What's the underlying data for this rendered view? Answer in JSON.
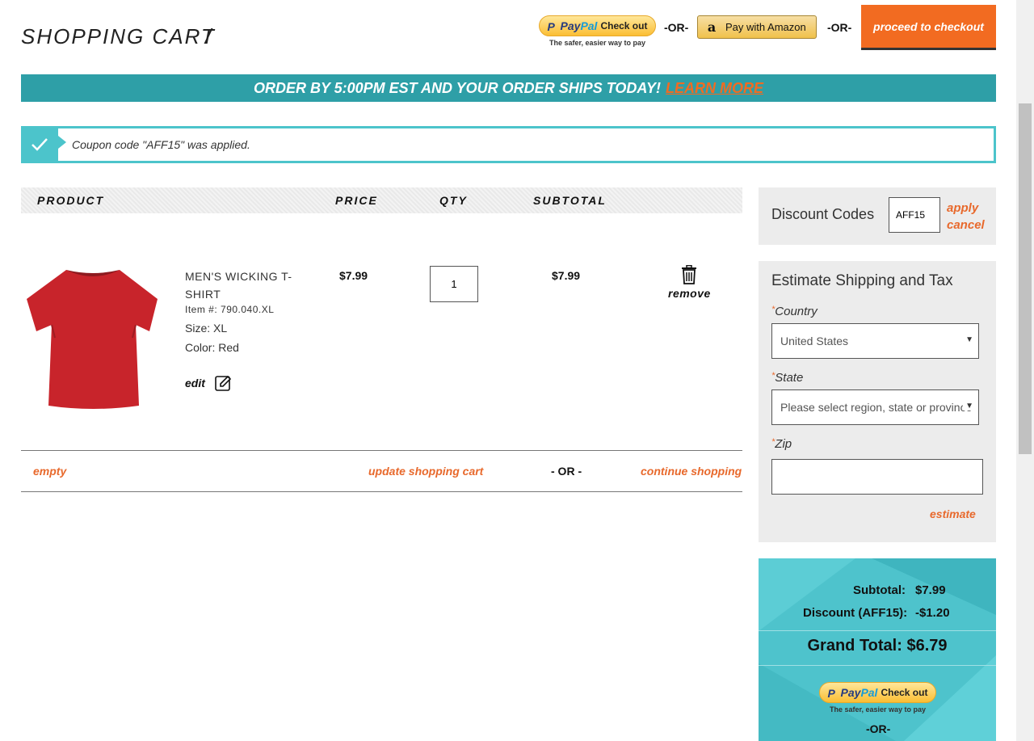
{
  "header": {
    "title": "SHOPPING CART",
    "slash": "/",
    "paypal": {
      "paypal_part1": "Pay",
      "paypal_part2": "Pal",
      "checkout": "Check out",
      "tagline": "The safer, easier way to pay"
    },
    "or1": "-OR-",
    "amazon_label": "Pay with Amazon",
    "or2": "-OR-",
    "checkout_label": "proceed to checkout"
  },
  "banner": {
    "text": "ORDER BY 5:00PM EST AND YOUR ORDER SHIPS TODAY!",
    "link": "LEARN MORE"
  },
  "coupon_message": "Coupon code \"AFF15\" was applied.",
  "table": {
    "headers": {
      "product": "PRODUCT",
      "price": "PRICE",
      "qty": "QTY",
      "subtotal": "SUBTOTAL"
    }
  },
  "item": {
    "name": "MEN'S WICKING T-SHIRT",
    "item_no": "Item #: 790.040.XL",
    "size": "Size: XL",
    "color": "Color: Red",
    "edit": "edit",
    "price": "$7.99",
    "qty": "1",
    "subtotal": "$7.99",
    "remove": "remove"
  },
  "actions": {
    "empty": "empty",
    "update": "update shopping cart",
    "or": "- OR -",
    "continue": "continue shopping"
  },
  "discount": {
    "label": "Discount Codes",
    "value": "AFF15",
    "apply": "apply",
    "cancel": "cancel"
  },
  "shipping": {
    "title": "Estimate Shipping and Tax",
    "country_label": "Country",
    "country_value": "United States",
    "state_label": "State",
    "state_value": "Please select region, state or province",
    "zip_label": "Zip",
    "estimate": "estimate",
    "required_mark": "*"
  },
  "totals": {
    "subtotal_label": "Subtotal:",
    "subtotal_value": "$7.99",
    "discount_label": "Discount (AFF15):",
    "discount_value": "-$1.20",
    "grand_label": "Grand Total:",
    "grand_value": "$6.79",
    "or": "-OR-"
  },
  "colors": {
    "accent_orange": "#f26b21",
    "teal": "#2e9fa7",
    "light_teal": "#4ec3cc",
    "panel_gray": "#ececec"
  }
}
